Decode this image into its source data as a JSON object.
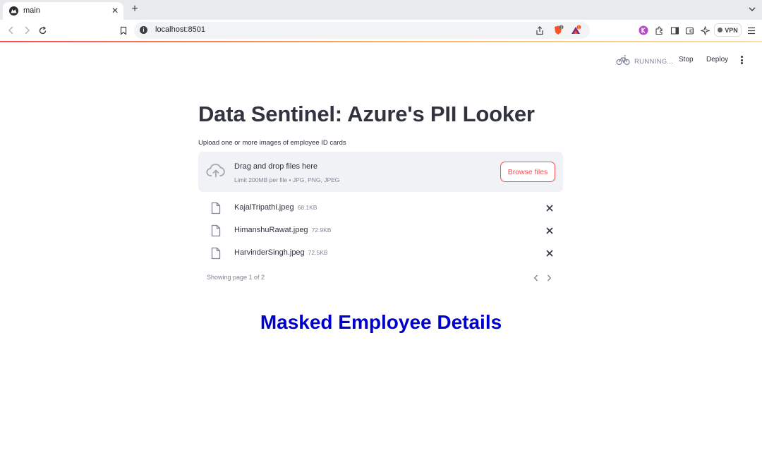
{
  "browser": {
    "tab_title": "main",
    "tab_close": "✕",
    "new_tab": "+",
    "url": "localhost:8501",
    "url_info": "i",
    "vpn_label": "VPN",
    "brave_badge": "1",
    "rewards_badge": "1"
  },
  "app_header": {
    "status": "RUNNING...",
    "stop_label": "Stop",
    "deploy_label": "Deploy"
  },
  "main": {
    "title": "Data Sentinel: Azure's PII Looker",
    "uploader": {
      "label": "Upload one or more images of employee ID cards",
      "drop_text": "Drag and drop files here",
      "limit_text": "Limit 200MB per file • JPG, PNG, JPEG",
      "browse_label": "Browse files"
    },
    "files": [
      {
        "name": "KajalTripathi.jpeg",
        "size": "68.1KB"
      },
      {
        "name": "HimanshuRawat.jpeg",
        "size": "72.9KB"
      },
      {
        "name": "HarvinderSingh.jpeg",
        "size": "72.5KB"
      }
    ],
    "pagination": "Showing page 1 of 2",
    "section_title": "Masked Employee Details"
  },
  "colors": {
    "accent": "#ff4b4b",
    "section_title": "#0000cd",
    "dropzone_bg": "#f0f2f6"
  },
  "icons": {
    "upload": "cloud-upload-icon",
    "file": "file-icon",
    "remove": "close-icon",
    "status": "bicycle-icon"
  }
}
